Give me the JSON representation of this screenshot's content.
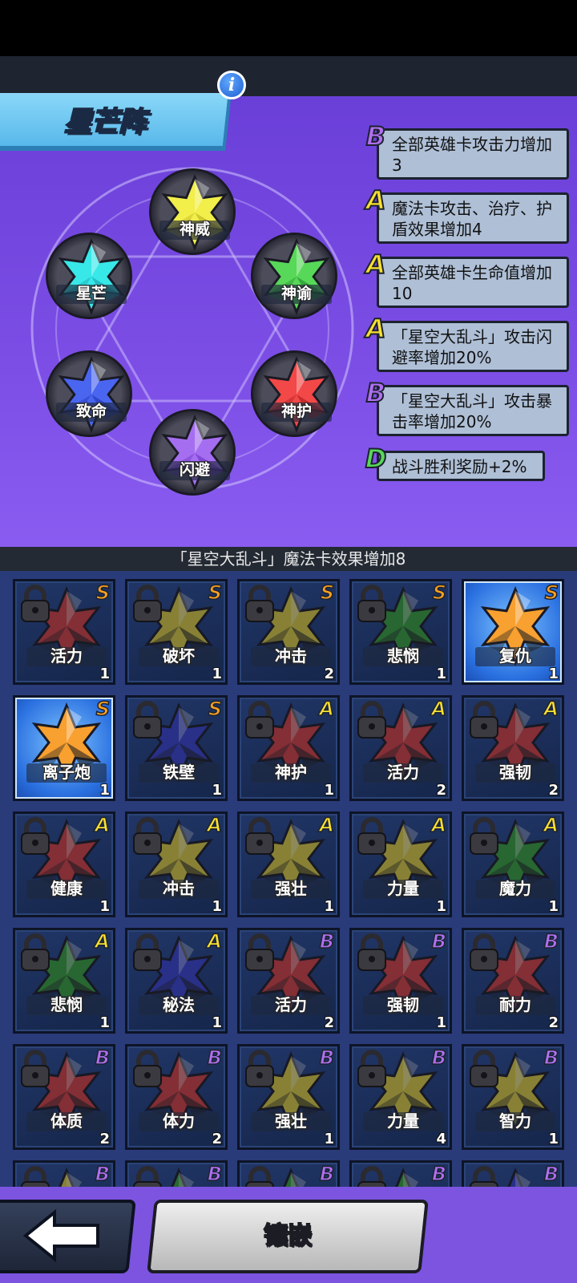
{
  "title": "星芒阵",
  "info_icon": "i",
  "nodes": [
    {
      "label": "神威",
      "color": "#f2ee4a",
      "dark": "#b8b020"
    },
    {
      "label": "神谕",
      "color": "#58d858",
      "dark": "#1f8a2a"
    },
    {
      "label": "神护",
      "color": "#f24848",
      "dark": "#a81a1a"
    },
    {
      "label": "闪避",
      "color": "#a56ef0",
      "dark": "#6a2ec8"
    },
    {
      "label": "致命",
      "color": "#4a66f0",
      "dark": "#1e32b0"
    },
    {
      "label": "星芒",
      "color": "#38e8e8",
      "dark": "#10a0b0"
    }
  ],
  "bonuses": [
    {
      "grade": "B",
      "grade_color": "#b070f0",
      "text": "全部英雄卡攻击力增加3"
    },
    {
      "grade": "A",
      "grade_color": "#f8e030",
      "text": "魔法卡攻击、治疗、护盾效果增加4"
    },
    {
      "grade": "A",
      "grade_color": "#f8e030",
      "text": "全部英雄卡生命值增加10"
    },
    {
      "grade": "A",
      "grade_color": "#f8e030",
      "text": "「星空大乱斗」攻击闪避率增加20%"
    },
    {
      "grade": "B",
      "grade_color": "#b070f0",
      "text": "「星空大乱斗」攻击暴击率增加20%"
    },
    {
      "grade": "D",
      "grade_color": "#58d858",
      "text": "战斗胜利奖励+2%"
    }
  ],
  "summary": "「星空大乱斗」魔法卡效果增加8",
  "cards": [
    {
      "label": "活力",
      "grade": "S",
      "count": "1",
      "color": "#e04040",
      "locked": true
    },
    {
      "label": "破坏",
      "grade": "S",
      "count": "1",
      "color": "#e8d840",
      "locked": true
    },
    {
      "label": "冲击",
      "grade": "S",
      "count": "2",
      "color": "#e8d840",
      "locked": true
    },
    {
      "label": "悲悯",
      "grade": "S",
      "count": "1",
      "color": "#3aa83a",
      "locked": true
    },
    {
      "label": "复仇",
      "grade": "S",
      "count": "1",
      "color": "#f8a030",
      "locked": false
    },
    {
      "label": "离子炮",
      "grade": "S",
      "count": "1",
      "color": "#f8a030",
      "locked": false
    },
    {
      "label": "铁壁",
      "grade": "S",
      "count": "1",
      "color": "#3a44d8",
      "locked": true
    },
    {
      "label": "神护",
      "grade": "A",
      "count": "1",
      "color": "#e04040",
      "locked": true
    },
    {
      "label": "活力",
      "grade": "A",
      "count": "2",
      "color": "#e04040",
      "locked": true
    },
    {
      "label": "强韧",
      "grade": "A",
      "count": "2",
      "color": "#e04040",
      "locked": true
    },
    {
      "label": "健康",
      "grade": "A",
      "count": "1",
      "color": "#e04040",
      "locked": true
    },
    {
      "label": "冲击",
      "grade": "A",
      "count": "1",
      "color": "#e8d840",
      "locked": true
    },
    {
      "label": "强壮",
      "grade": "A",
      "count": "1",
      "color": "#e8d840",
      "locked": true
    },
    {
      "label": "力量",
      "grade": "A",
      "count": "1",
      "color": "#e8d840",
      "locked": true
    },
    {
      "label": "魔力",
      "grade": "A",
      "count": "1",
      "color": "#3aa83a",
      "locked": true
    },
    {
      "label": "悲悯",
      "grade": "A",
      "count": "1",
      "color": "#3aa83a",
      "locked": true
    },
    {
      "label": "秘法",
      "grade": "A",
      "count": "1",
      "color": "#3a44d8",
      "locked": true
    },
    {
      "label": "活力",
      "grade": "B",
      "count": "2",
      "color": "#e04040",
      "locked": true
    },
    {
      "label": "强韧",
      "grade": "B",
      "count": "1",
      "color": "#e04040",
      "locked": true
    },
    {
      "label": "耐力",
      "grade": "B",
      "count": "2",
      "color": "#e04040",
      "locked": true
    },
    {
      "label": "体质",
      "grade": "B",
      "count": "2",
      "color": "#e04040",
      "locked": true
    },
    {
      "label": "体力",
      "grade": "B",
      "count": "2",
      "color": "#e04040",
      "locked": true
    },
    {
      "label": "强壮",
      "grade": "B",
      "count": "1",
      "color": "#e8d840",
      "locked": true
    },
    {
      "label": "力量",
      "grade": "B",
      "count": "4",
      "color": "#e8d840",
      "locked": true
    },
    {
      "label": "智力",
      "grade": "B",
      "count": "1",
      "color": "#e8d840",
      "locked": true
    },
    {
      "label": "",
      "grade": "B",
      "count": "",
      "color": "#e8d840",
      "locked": true
    },
    {
      "label": "",
      "grade": "B",
      "count": "",
      "color": "#3aa83a",
      "locked": true
    },
    {
      "label": "",
      "grade": "B",
      "count": "",
      "color": "#3aa83a",
      "locked": true
    },
    {
      "label": "",
      "grade": "B",
      "count": "",
      "color": "#3aa83a",
      "locked": true
    },
    {
      "label": "",
      "grade": "B",
      "count": "",
      "color": "#3a44d8",
      "locked": true
    }
  ],
  "grade_colors": {
    "S": "#f8a020",
    "A": "#f8e030",
    "B": "#b070f0"
  },
  "back_icon": "back-arrow-icon",
  "embed_label": "镶嵌"
}
